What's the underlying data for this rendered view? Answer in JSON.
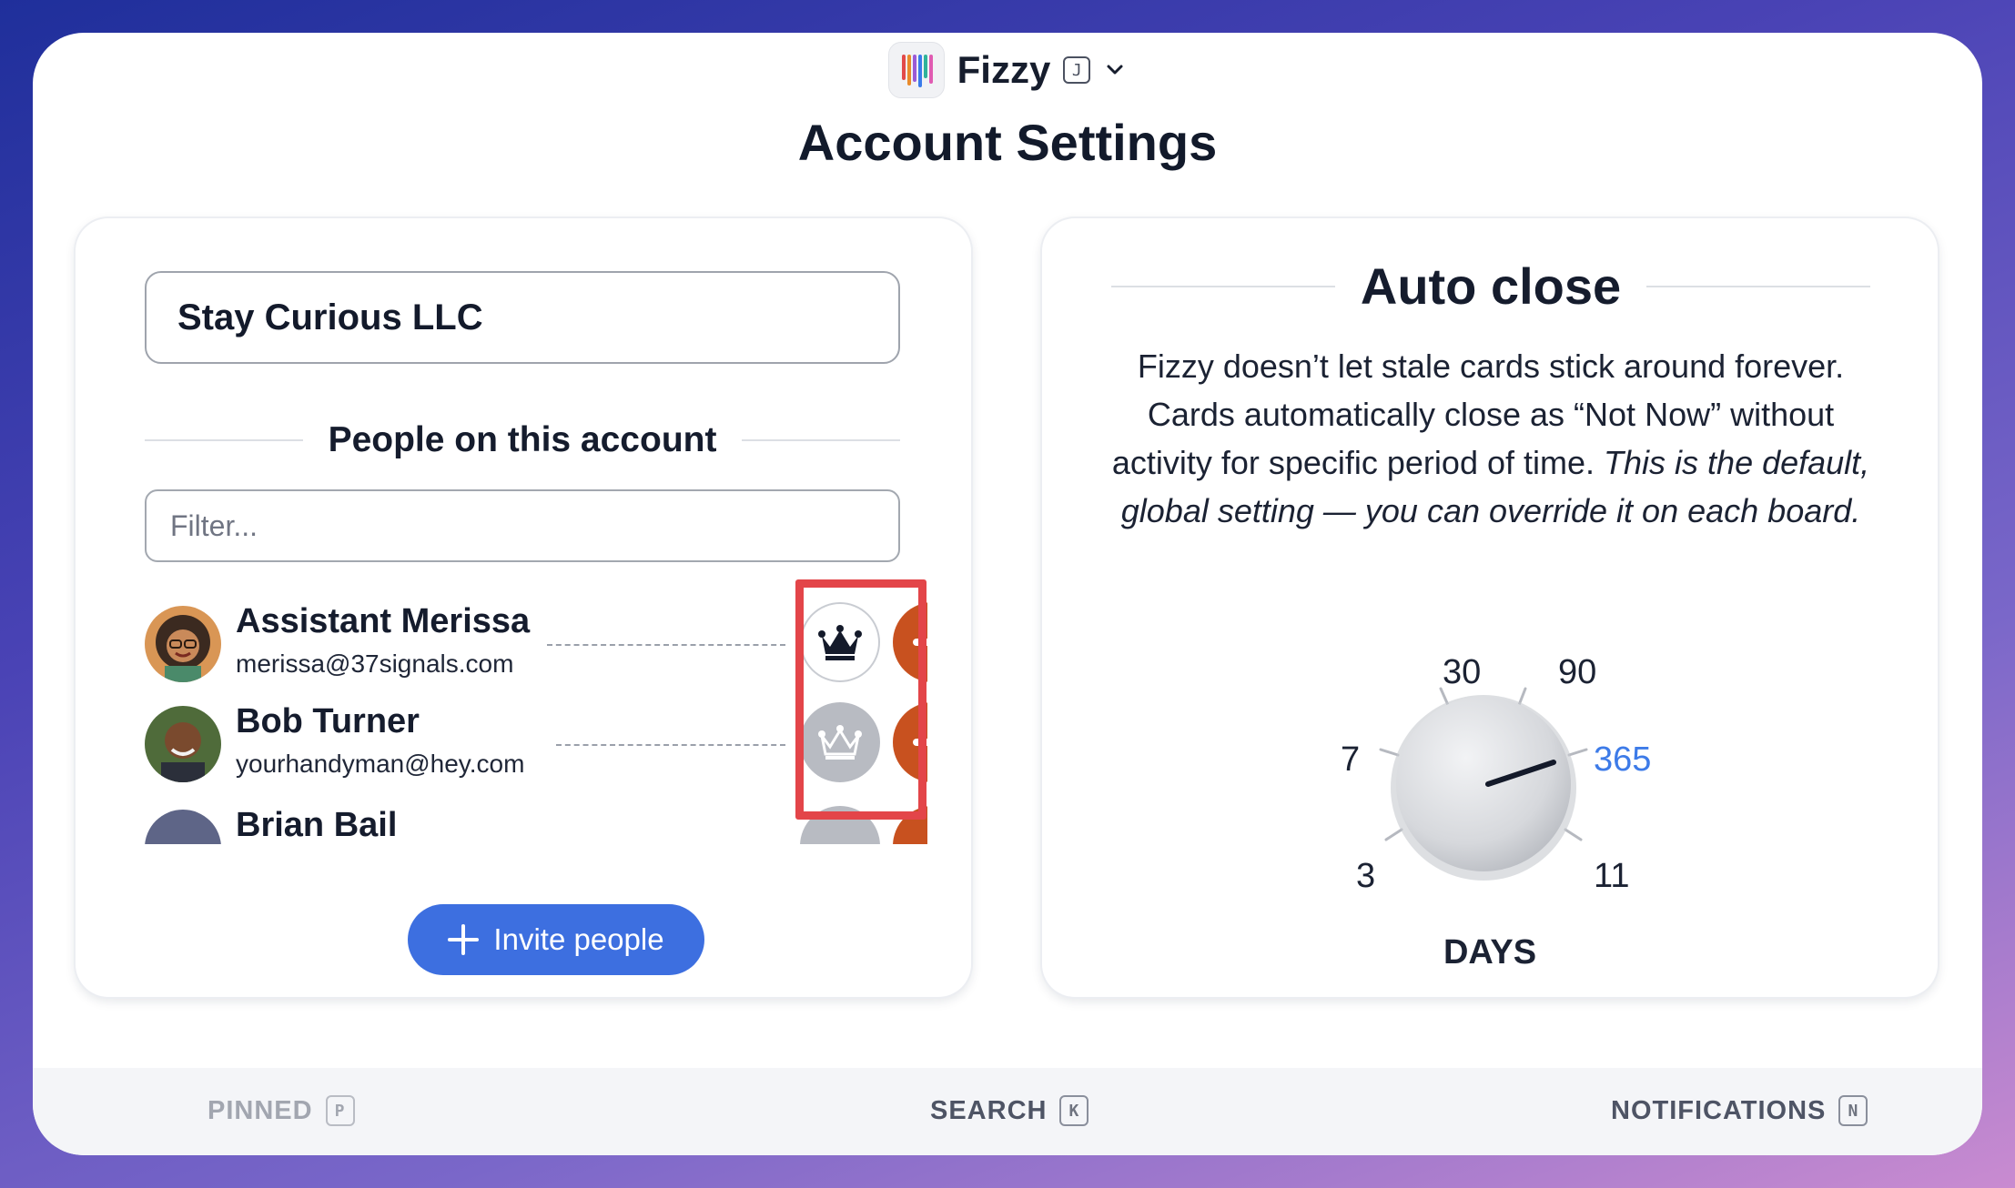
{
  "header": {
    "app_name": "Fizzy",
    "app_shortcut": "J",
    "page_title": "Account Settings"
  },
  "account": {
    "name": "Stay Curious LLC"
  },
  "people_section": {
    "heading": "People on this account",
    "filter_placeholder": "Filter...",
    "people": [
      {
        "name": "Assistant Merissa",
        "email": "merissa@37signals.com",
        "admin": true
      },
      {
        "name": "Bob Turner",
        "email": "yourhandyman@hey.com",
        "admin": false
      },
      {
        "name": "Brian Bail",
        "email": "",
        "admin": false
      }
    ],
    "invite_label": "Invite people"
  },
  "auto_close": {
    "heading": "Auto close",
    "description_plain": "Fizzy doesn’t let stale cards stick around forever. Cards automatically close as “Not Now” without activity for specific period of time.",
    "description_italic": "This is the default, global setting — you can override it on each board.",
    "dial_options": [
      "3",
      "7",
      "30",
      "90",
      "365",
      "11"
    ],
    "selected": "365",
    "unit_label": "DAYS"
  },
  "bottom_nav": {
    "pinned": {
      "label": "PINNED",
      "key": "P"
    },
    "search": {
      "label": "SEARCH",
      "key": "K"
    },
    "notifications": {
      "label": "NOTIFICATIONS",
      "key": "N"
    }
  },
  "colors": {
    "accent": "#3d6fe0",
    "remove": "#c8511f",
    "highlight": "#e34549",
    "selected_option": "#3d7be8"
  }
}
